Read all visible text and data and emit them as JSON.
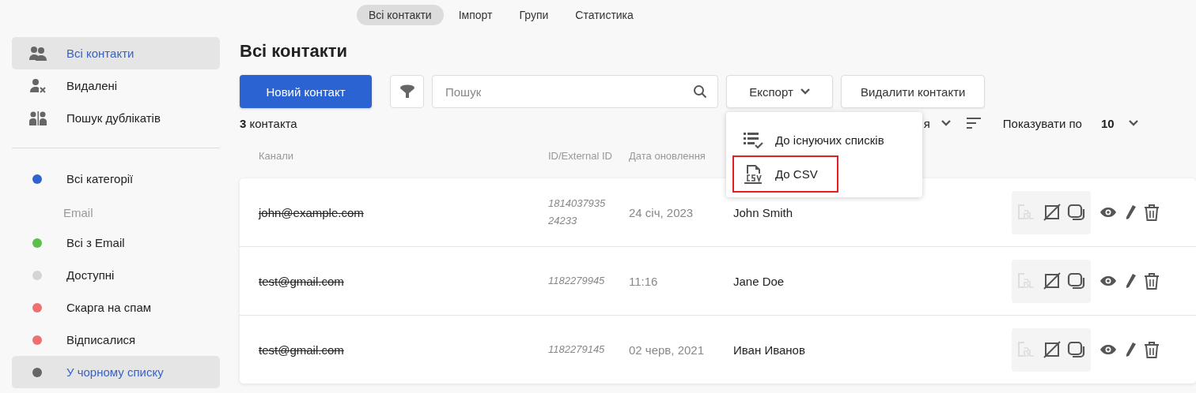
{
  "top_tabs": [
    {
      "label": "Всі контакти",
      "selected": true
    },
    {
      "label": "Імпорт",
      "selected": false
    },
    {
      "label": "Групи",
      "selected": false
    },
    {
      "label": "Статистика",
      "selected": false
    }
  ],
  "sidebar": {
    "items": [
      {
        "kind": "people",
        "label": "Всі контакти",
        "selected": true
      },
      {
        "kind": "person-remove",
        "label": "Видалені",
        "selected": false
      },
      {
        "kind": "duplicates",
        "label": "Пошук дублікатів",
        "selected": false
      }
    ],
    "categories": [
      {
        "kind": "dot",
        "label": "Всі категорії",
        "color": "#2f64d0",
        "selected": false
      },
      {
        "kind": "heading",
        "label": "Email"
      },
      {
        "kind": "dot",
        "label": "Всі з Email",
        "color": "#5cbf4a",
        "selected": false
      },
      {
        "kind": "dot",
        "label": "Доступні",
        "color": "#d4d4d4",
        "selected": false
      },
      {
        "kind": "dot",
        "label": "Скарга на спам",
        "color": "#ee7070",
        "selected": false
      },
      {
        "kind": "dot",
        "label": "Відписалися",
        "color": "#ee7070",
        "selected": false
      },
      {
        "kind": "dot",
        "label": "У чорному списку",
        "color": "#666666",
        "selected": true
      }
    ]
  },
  "title": "Всі контакти",
  "new_button": "Новий контакт",
  "search": {
    "placeholder": "Пошук"
  },
  "export_button": "Експорт",
  "delete_button": "Видалити контакти",
  "count": {
    "number": "3",
    "label": "контакта"
  },
  "sort_label": "я",
  "per_page": {
    "label": "Показувати по",
    "value": "10"
  },
  "table": {
    "columns": [
      "Канали",
      "ID/External ID",
      "Дата оновлення"
    ],
    "rows": [
      {
        "channel": "john@example.com",
        "id": [
          "1814037935",
          "24233"
        ],
        "date": "24 січ, 2023",
        "name": "John Smith"
      },
      {
        "channel": "test@gmail.com",
        "id": [
          "1182279945"
        ],
        "date": "11:16",
        "name": "Jane Doe"
      },
      {
        "channel": "test@gmail.com",
        "id": [
          "1182279145"
        ],
        "date": "02 черв, 2021",
        "name": "Иван Иванов"
      }
    ]
  },
  "export_menu": [
    {
      "kind": "lists",
      "label": "До існуючих списків",
      "highlighted": false
    },
    {
      "kind": "csv",
      "label": "До CSV",
      "highlighted": true
    }
  ]
}
